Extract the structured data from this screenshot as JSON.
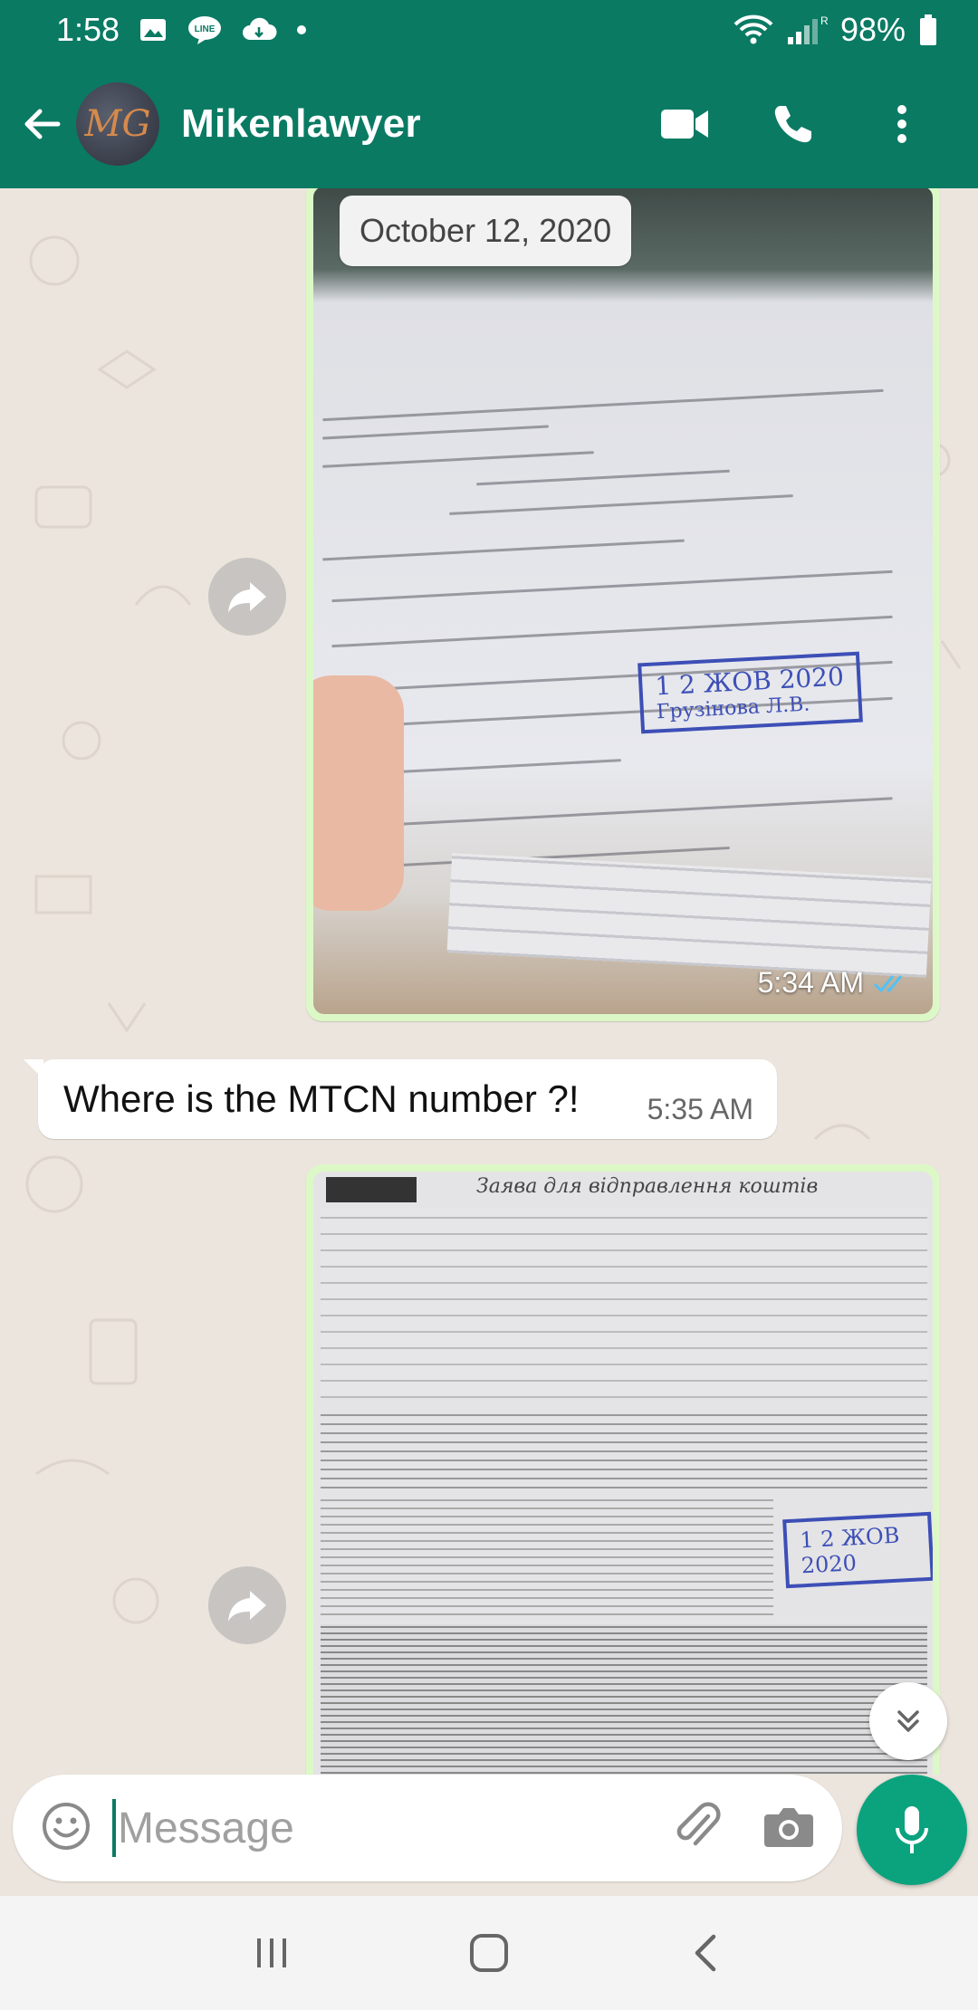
{
  "status_bar": {
    "time": "1:58",
    "battery": "98%",
    "left_icons": [
      "gallery-icon",
      "line-icon",
      "cloud-icon",
      "dot-icon"
    ],
    "right_icons": [
      "wifi-icon",
      "signal-icon",
      "battery-icon"
    ],
    "signal_label": "R"
  },
  "app_bar": {
    "contact_name": "Mikenlawyer",
    "avatar_initials": "MG",
    "actions": [
      "video-call-icon",
      "call-icon",
      "more-icon"
    ]
  },
  "chat": {
    "date_chip": "October 12, 2020",
    "messages": [
      {
        "type": "image",
        "direction": "outgoing",
        "description_icon": "receipt-photo",
        "time": "5:34 AM",
        "status": "read",
        "stamp_text": "1 2 ЖОВ 2020",
        "stamp_name": "Грузінова Л.В."
      },
      {
        "type": "text",
        "direction": "incoming",
        "text": "Where is the MTCN number ?!",
        "time": "5:35 AM"
      },
      {
        "type": "image",
        "direction": "outgoing",
        "description_icon": "western-union-form-photo",
        "header_text": "Заява для відправлення коштів",
        "stamp_text": "1 2 ЖОВ 2020"
      }
    ]
  },
  "input_bar": {
    "placeholder": "Message",
    "icons": [
      "emoji-icon",
      "attach-icon",
      "camera-icon",
      "mic-icon"
    ]
  },
  "nav_bar": {
    "buttons": [
      "recents-icon",
      "home-icon",
      "back-icon"
    ]
  },
  "colors": {
    "primary": "#0a7a63",
    "accent": "#0aa37d",
    "outgoing_bubble": "#dcf8c6",
    "chat_bg": "#ece5dd",
    "read_ticks": "#4fc3f7"
  }
}
